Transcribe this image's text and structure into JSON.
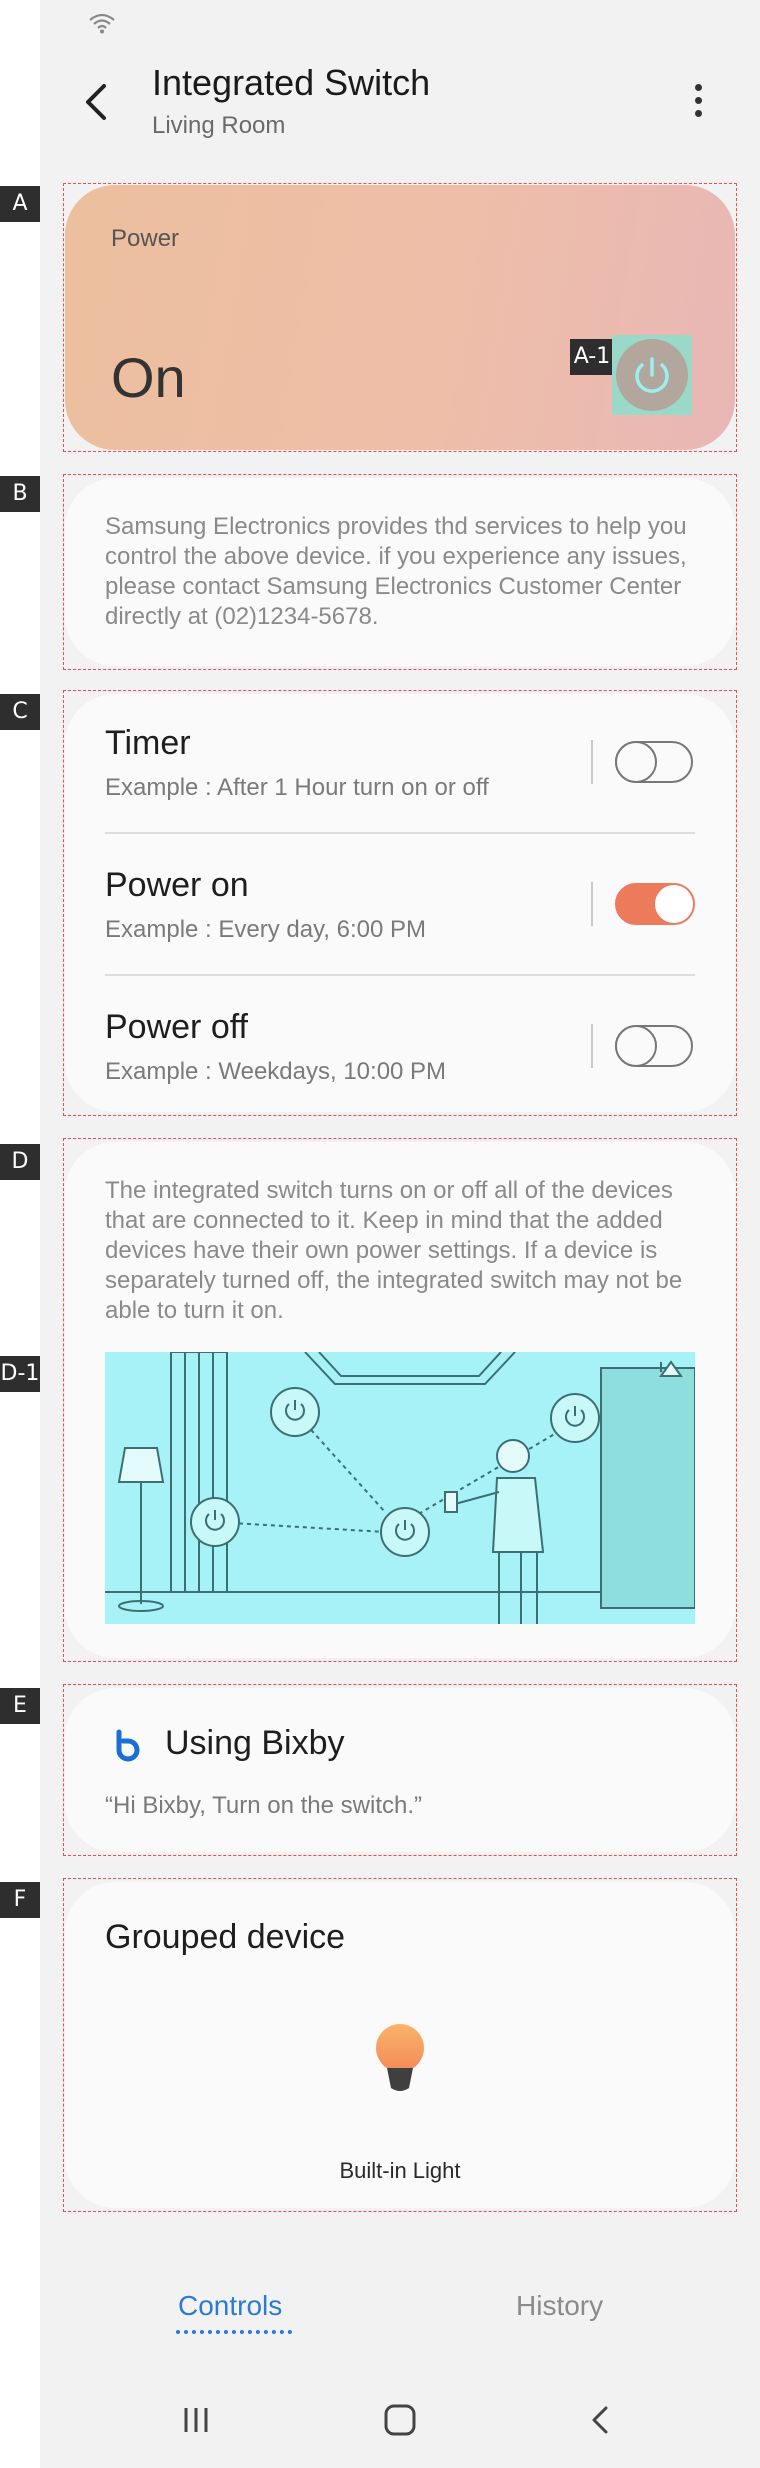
{
  "header": {
    "title": "Integrated Switch",
    "subtitle": "Living Room"
  },
  "tags": {
    "A": "A",
    "A1": "A-1",
    "B": "B",
    "C": "C",
    "D": "D",
    "D1": "D-1",
    "E": "E",
    "F": "F"
  },
  "power": {
    "label": "Power",
    "state": "On"
  },
  "notice": {
    "text": "Samsung Electronics provides thd services to help you control the above device. if you experience any issues, please contact Samsung Electronics Customer Center directly at (02)1234-5678."
  },
  "schedules": [
    {
      "title": "Timer",
      "example": "Example : After 1 Hour turn on or off",
      "enabled": false
    },
    {
      "title": "Power on",
      "example": "Example : Every day, 6:00 PM",
      "enabled": true
    },
    {
      "title": "Power off",
      "example": "Example : Weekdays, 10:00 PM",
      "enabled": false
    }
  ],
  "description": {
    "text": "The integrated switch turns on or off all of the devices that are connected to it. Keep in mind that the added devices have their own power settings. If a device is separately turned off, the integrated switch may not be able to turn it on."
  },
  "bixby": {
    "title": "Using Bixby",
    "example": "“Hi Bixby, Turn on the switch.”"
  },
  "grouped": {
    "title": "Grouped device",
    "device_name": "Built-in Light"
  },
  "tabs": {
    "controls": "Controls",
    "history": "History",
    "active": "Controls"
  },
  "colors": {
    "accent": "#2a7ad6",
    "toggle_on": "#ec7b5c",
    "annotation_border": "#f04a4a",
    "illustration_bg": "#a6f2f6"
  },
  "icons": {
    "back": "chevron-left-icon",
    "more": "more-vertical-icon",
    "power": "power-icon",
    "bixby": "bixby-icon",
    "bulb": "bulb-icon",
    "wifi": "wifi-icon"
  }
}
